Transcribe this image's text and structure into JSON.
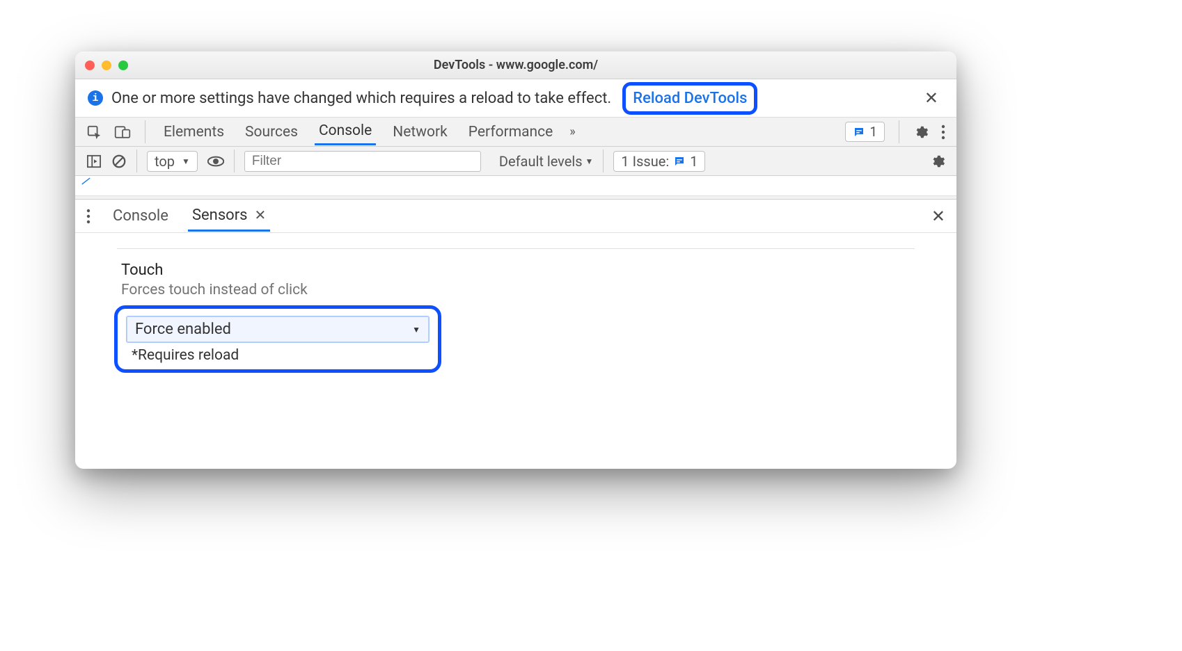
{
  "window": {
    "title": "DevTools - www.google.com/"
  },
  "infobar": {
    "message": "One or more settings have changed which requires a reload to take effect.",
    "reload_label": "Reload DevTools"
  },
  "tabs": {
    "items": [
      "Elements",
      "Sources",
      "Console",
      "Network",
      "Performance"
    ],
    "active_index": 2,
    "issues_count": "1"
  },
  "filterbar": {
    "context": "top",
    "filter_placeholder": "Filter",
    "levels": "Default levels",
    "issues_label": "1 Issue:",
    "issues_count": "1"
  },
  "drawer": {
    "tabs": [
      "Console",
      "Sensors"
    ],
    "active_index": 1
  },
  "sensors": {
    "touch": {
      "title": "Touch",
      "subtitle": "Forces touch instead of click",
      "selected": "Force enabled",
      "note": "*Requires reload"
    }
  }
}
